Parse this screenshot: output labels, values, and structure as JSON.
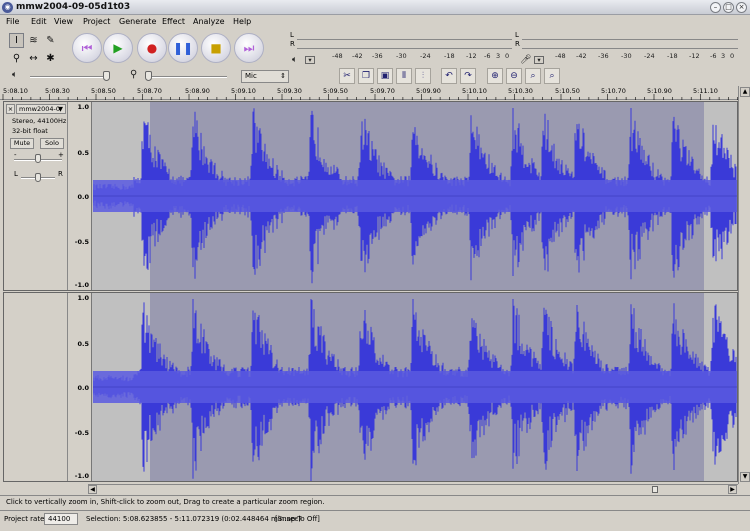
{
  "window": {
    "title": "mmw2004-09-05d1t03"
  },
  "menu": [
    "File",
    "Edit",
    "View",
    "Project",
    "Generate",
    "Effect",
    "Analyze",
    "Help"
  ],
  "meters": {
    "left_ch": "L",
    "right_ch": "R",
    "ticks": [
      "-48",
      "-42",
      "-36",
      "-30",
      "-24",
      "-18",
      "-12",
      "-6",
      "3",
      "0"
    ],
    "play_icon": "speaker-icon",
    "rec_icon": "microphone-icon"
  },
  "mixer": {
    "input_select": "Mic"
  },
  "ruler": {
    "labels": [
      "5:08.10",
      "5:08.30",
      "5:08.50",
      "5:08.70",
      "5:08.90",
      "5:09.10",
      "5:09.30",
      "5:09.50",
      "5:09.70",
      "5:09.90",
      "5:10.10",
      "5:10.30",
      "5:10.50",
      "5:10.70",
      "5:10.90",
      "5:11.10"
    ]
  },
  "track": {
    "name": "mmw2004-0",
    "format": "Stereo, 44100Hz",
    "bits": "32-bit float",
    "mute": "Mute",
    "solo": "Solo",
    "gain_minus": "-",
    "gain_plus": "+",
    "pan_left": "L",
    "pan_right": "R",
    "close": "×",
    "scale": [
      "1.0",
      "0.5",
      "0.0",
      "-0.5",
      "-1.0"
    ]
  },
  "status": {
    "hint": "Click to vertically zoom in, Shift-click to zoom out, Drag to create a particular zoom region."
  },
  "bottom": {
    "rate_label": "Project rate:",
    "rate_value": "44100",
    "selection": "Selection: 5:08.623855 - 5:11.072319 (0:02.448464 min:sec)",
    "snap": "[Snap-To Off]"
  },
  "colors": {
    "wave": "#3a3ad8",
    "wave_fill": "#5a5ae0",
    "selection_bg": "#9a9ab0",
    "unselected_bg": "#c0c0c0"
  }
}
